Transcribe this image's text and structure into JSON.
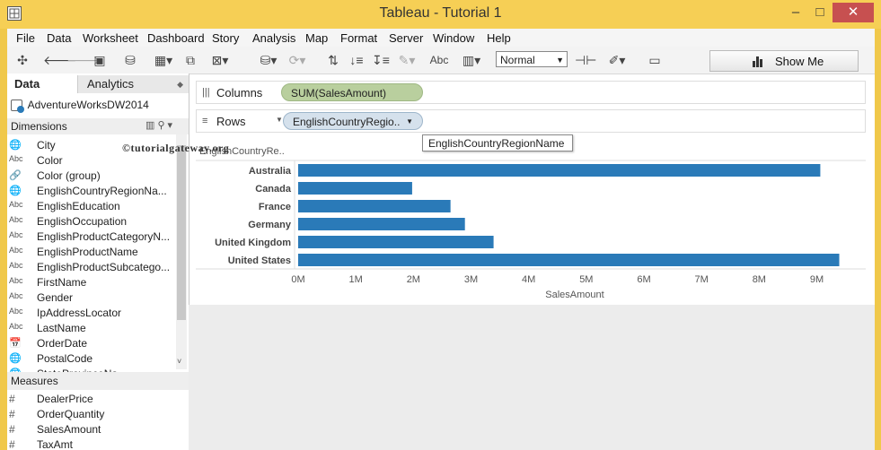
{
  "window": {
    "title": "Tableau - Tutorial 1",
    "controls": {
      "minimize": "‒",
      "maximize": "□",
      "close": "✕"
    }
  },
  "menu": [
    "File",
    "Data",
    "Worksheet",
    "Dashboard",
    "Story",
    "Analysis",
    "Map",
    "Format",
    "Server",
    "Window",
    "Help"
  ],
  "toolbar": {
    "icons": [
      "tableau-logo-icon",
      "back-icon",
      "forward-icon",
      "save-icon",
      "new-datasource-icon",
      "new-sheet-icon",
      "duplicate-sheet-icon",
      "clear-sheet-icon",
      "pause-updates-icon",
      "refresh-icon",
      "swap-icon",
      "sort-ascending-icon",
      "sort-descending-icon",
      "highlight-icon",
      "labels-icon",
      "chart-type-icon",
      "pin-icon",
      "pen-icon",
      "presentation-icon"
    ],
    "labels_text": "Abc",
    "fit_select": "Normal",
    "show_me": "Show Me"
  },
  "data_pane": {
    "tabs": {
      "data": "Data",
      "analytics": "Analytics"
    },
    "datasource": "AdventureWorksDW2014",
    "dimensions_title": "Dimensions",
    "dimensions": [
      {
        "type": "geo",
        "name": "City"
      },
      {
        "type": "abc",
        "name": "Color"
      },
      {
        "type": "group",
        "name": "Color (group)"
      },
      {
        "type": "geo",
        "name": "EnglishCountryRegionNa..."
      },
      {
        "type": "abc",
        "name": "EnglishEducation"
      },
      {
        "type": "abc",
        "name": "EnglishOccupation"
      },
      {
        "type": "abc",
        "name": "EnglishProductCategoryN..."
      },
      {
        "type": "abc",
        "name": "EnglishProductName"
      },
      {
        "type": "abc",
        "name": "EnglishProductSubcatego..."
      },
      {
        "type": "abc",
        "name": "FirstName"
      },
      {
        "type": "abc",
        "name": "Gender"
      },
      {
        "type": "abc",
        "name": "IpAddressLocator"
      },
      {
        "type": "abc",
        "name": "LastName"
      },
      {
        "type": "date",
        "name": "OrderDate"
      },
      {
        "type": "geo",
        "name": "PostalCode"
      },
      {
        "type": "geo",
        "name": "StateProvinceNa..."
      }
    ],
    "measures_title": "Measures",
    "measures": [
      "DealerPrice",
      "OrderQuantity",
      "SalesAmount",
      "TaxAmt"
    ],
    "watermark": "©tutorialgateway.org"
  },
  "shelves": {
    "columns_label": "Columns",
    "columns_pill": "SUM(SalesAmount)",
    "rows_label": "Rows",
    "rows_pill": "EnglishCountryRegio..",
    "tooltip": "EnglishCountryRegionName"
  },
  "chart_data": {
    "type": "bar",
    "orientation": "horizontal",
    "row_header": "EnglishCountryRe..",
    "categories": [
      "Australia",
      "Canada",
      "France",
      "Germany",
      "United Kingdom",
      "United States"
    ],
    "values": [
      9061000,
      1978000,
      2644000,
      2894000,
      3391000,
      9390000
    ],
    "xlabel": "SalesAmount",
    "xlim": [
      0,
      9600000
    ],
    "ticks": [
      {
        "v": 0,
        "label": "0M"
      },
      {
        "v": 1000000,
        "label": "1M"
      },
      {
        "v": 2000000,
        "label": "2M"
      },
      {
        "v": 3000000,
        "label": "3M"
      },
      {
        "v": 4000000,
        "label": "4M"
      },
      {
        "v": 5000000,
        "label": "5M"
      },
      {
        "v": 6000000,
        "label": "6M"
      },
      {
        "v": 7000000,
        "label": "7M"
      },
      {
        "v": 8000000,
        "label": "8M"
      },
      {
        "v": 9000000,
        "label": "9M"
      }
    ],
    "bar_color": "#2a7ab8",
    "grid": false
  }
}
